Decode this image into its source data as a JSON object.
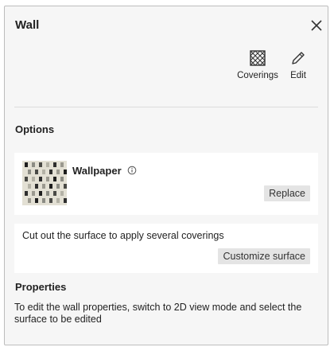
{
  "panel": {
    "title": "Wall"
  },
  "toolbar": {
    "coverings_label": "Coverings",
    "edit_label": "Edit"
  },
  "options": {
    "title": "Options",
    "wallpaper": {
      "name": "Wallpaper",
      "replace_label": "Replace"
    },
    "cutout": {
      "text": "Cut out the surface to apply several coverings",
      "customize_label": "Customize surface"
    }
  },
  "properties": {
    "title": "Properties",
    "text": "To edit the wall properties, switch to 2D view mode and select the surface to be edited"
  },
  "icons": {
    "close": "close-icon",
    "coverings": "hatched-square-icon",
    "edit": "pencil-icon",
    "info": "info-icon"
  },
  "colors": {
    "panel_bg": "#f6f6f6",
    "card_bg": "#ffffff",
    "button_bg": "#e4e4e4",
    "border": "#bdbdbd"
  }
}
